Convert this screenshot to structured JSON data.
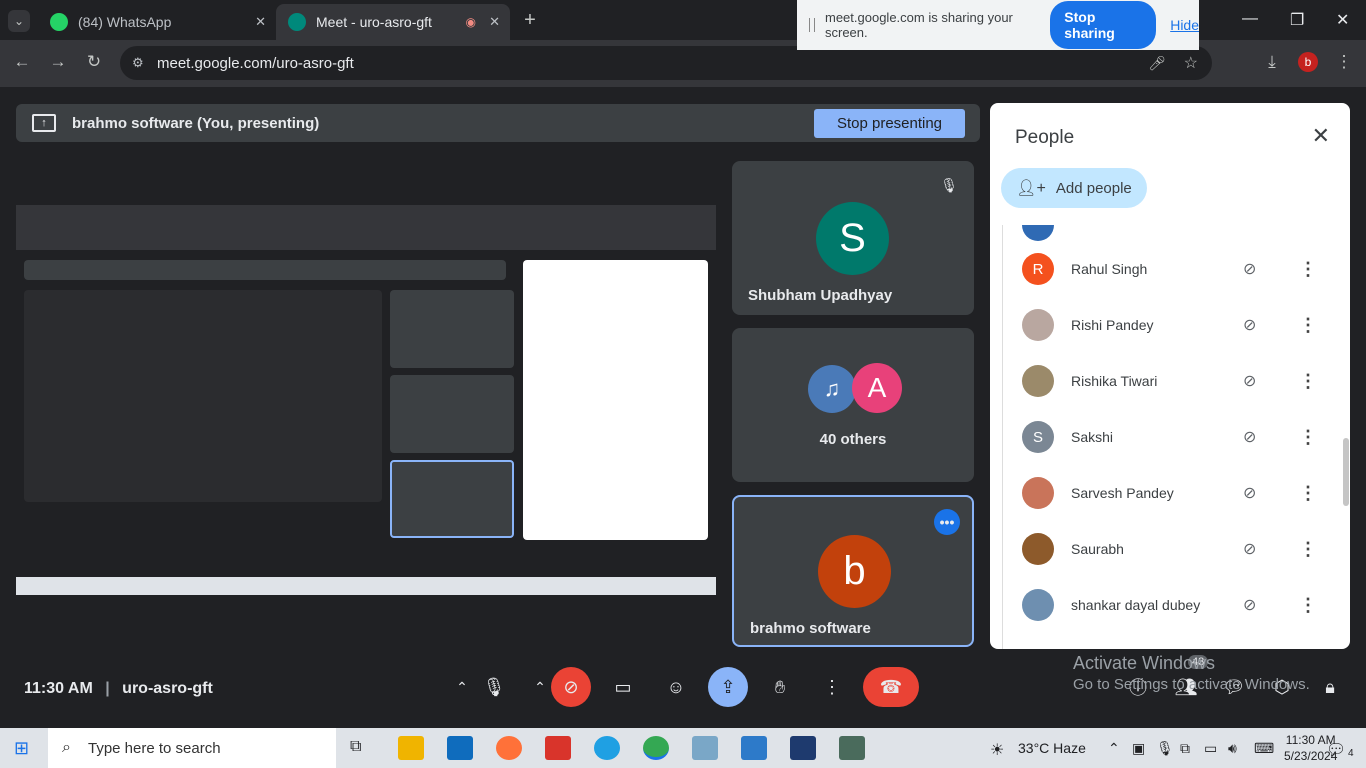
{
  "browser": {
    "tabs": [
      {
        "title": "(84) WhatsApp",
        "color": "#25d366"
      },
      {
        "title": "Meet - uro-asro-gft",
        "color": "#00897b"
      }
    ],
    "url": "meet.google.com/uro-asro-gft",
    "profile_initial": "b"
  },
  "share_bar": {
    "message": "meet.google.com is sharing your screen.",
    "stop_label": "Stop sharing",
    "hide_label": "Hide"
  },
  "presenting": {
    "label": "brahmo software (You, presenting)",
    "stop_label": "Stop presenting"
  },
  "tiles": [
    {
      "name": "Shubham Upadhyay",
      "initial": "S",
      "color": "#00796b"
    },
    {
      "name": "40 others",
      "initial": "A",
      "color": "#e8417a"
    },
    {
      "name": "brahmo software",
      "initial": "b",
      "color": "#c2410c"
    }
  ],
  "people": {
    "title": "People",
    "add_label": "Add people",
    "list": [
      {
        "name": "Rahul Singh",
        "initial": "R",
        "color": "#f4511e"
      },
      {
        "name": "Rishi Pandey",
        "initial": "",
        "color": "#b9a7a0"
      },
      {
        "name": "Rishika Tiwari",
        "initial": "",
        "color": "#9b8a6a"
      },
      {
        "name": "Sakshi",
        "initial": "S",
        "color": "#7b8794"
      },
      {
        "name": "Sarvesh Pandey",
        "initial": "",
        "color": "#c9745a"
      },
      {
        "name": "Saurabh",
        "initial": "",
        "color": "#8d5a2b"
      },
      {
        "name": "shankar dayal dubey",
        "initial": "",
        "color": "#6e8fb0"
      }
    ]
  },
  "meeting": {
    "time": "11:30 AM",
    "code": "uro-asro-gft",
    "participant_count": "43"
  },
  "watermark": {
    "line1": "Activate Windows",
    "line2": "Go to Settings to activate Windows."
  },
  "taskbar": {
    "search_placeholder": "Type here to search",
    "weather": "33°C  Haze",
    "time": "11:30 AM",
    "date": "5/23/2024",
    "notifications": "4"
  }
}
